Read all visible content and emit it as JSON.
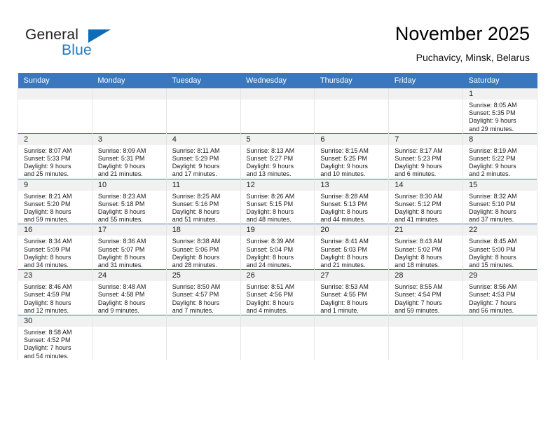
{
  "logo": {
    "word1": "General",
    "word2": "Blue",
    "triangle_color": "#0f6cb5",
    "blue_text_color": "#1a7bc4"
  },
  "header": {
    "title": "November 2025",
    "subtitle": "Puchavicy, Minsk, Belarus"
  },
  "theme": {
    "header_row_bg": "#3b77bc",
    "header_row_text": "#ffffff",
    "daynum_band_bg": "#f1f1f1",
    "cell_bg": "#ffffff",
    "row_divider": "#3b77bc",
    "cell_border": "#e4e4e4"
  },
  "weekdays": [
    "Sunday",
    "Monday",
    "Tuesday",
    "Wednesday",
    "Thursday",
    "Friday",
    "Saturday"
  ],
  "weeks": [
    [
      {
        "day": "",
        "lines": []
      },
      {
        "day": "",
        "lines": []
      },
      {
        "day": "",
        "lines": []
      },
      {
        "day": "",
        "lines": []
      },
      {
        "day": "",
        "lines": []
      },
      {
        "day": "",
        "lines": []
      },
      {
        "day": "1",
        "lines": [
          "Sunrise: 8:05 AM",
          "Sunset: 5:35 PM",
          "Daylight: 9 hours",
          "and 29 minutes."
        ]
      }
    ],
    [
      {
        "day": "2",
        "lines": [
          "Sunrise: 8:07 AM",
          "Sunset: 5:33 PM",
          "Daylight: 9 hours",
          "and 25 minutes."
        ]
      },
      {
        "day": "3",
        "lines": [
          "Sunrise: 8:09 AM",
          "Sunset: 5:31 PM",
          "Daylight: 9 hours",
          "and 21 minutes."
        ]
      },
      {
        "day": "4",
        "lines": [
          "Sunrise: 8:11 AM",
          "Sunset: 5:29 PM",
          "Daylight: 9 hours",
          "and 17 minutes."
        ]
      },
      {
        "day": "5",
        "lines": [
          "Sunrise: 8:13 AM",
          "Sunset: 5:27 PM",
          "Daylight: 9 hours",
          "and 13 minutes."
        ]
      },
      {
        "day": "6",
        "lines": [
          "Sunrise: 8:15 AM",
          "Sunset: 5:25 PM",
          "Daylight: 9 hours",
          "and 10 minutes."
        ]
      },
      {
        "day": "7",
        "lines": [
          "Sunrise: 8:17 AM",
          "Sunset: 5:23 PM",
          "Daylight: 9 hours",
          "and 6 minutes."
        ]
      },
      {
        "day": "8",
        "lines": [
          "Sunrise: 8:19 AM",
          "Sunset: 5:22 PM",
          "Daylight: 9 hours",
          "and 2 minutes."
        ]
      }
    ],
    [
      {
        "day": "9",
        "lines": [
          "Sunrise: 8:21 AM",
          "Sunset: 5:20 PM",
          "Daylight: 8 hours",
          "and 59 minutes."
        ]
      },
      {
        "day": "10",
        "lines": [
          "Sunrise: 8:23 AM",
          "Sunset: 5:18 PM",
          "Daylight: 8 hours",
          "and 55 minutes."
        ]
      },
      {
        "day": "11",
        "lines": [
          "Sunrise: 8:25 AM",
          "Sunset: 5:16 PM",
          "Daylight: 8 hours",
          "and 51 minutes."
        ]
      },
      {
        "day": "12",
        "lines": [
          "Sunrise: 8:26 AM",
          "Sunset: 5:15 PM",
          "Daylight: 8 hours",
          "and 48 minutes."
        ]
      },
      {
        "day": "13",
        "lines": [
          "Sunrise: 8:28 AM",
          "Sunset: 5:13 PM",
          "Daylight: 8 hours",
          "and 44 minutes."
        ]
      },
      {
        "day": "14",
        "lines": [
          "Sunrise: 8:30 AM",
          "Sunset: 5:12 PM",
          "Daylight: 8 hours",
          "and 41 minutes."
        ]
      },
      {
        "day": "15",
        "lines": [
          "Sunrise: 8:32 AM",
          "Sunset: 5:10 PM",
          "Daylight: 8 hours",
          "and 37 minutes."
        ]
      }
    ],
    [
      {
        "day": "16",
        "lines": [
          "Sunrise: 8:34 AM",
          "Sunset: 5:09 PM",
          "Daylight: 8 hours",
          "and 34 minutes."
        ]
      },
      {
        "day": "17",
        "lines": [
          "Sunrise: 8:36 AM",
          "Sunset: 5:07 PM",
          "Daylight: 8 hours",
          "and 31 minutes."
        ]
      },
      {
        "day": "18",
        "lines": [
          "Sunrise: 8:38 AM",
          "Sunset: 5:06 PM",
          "Daylight: 8 hours",
          "and 28 minutes."
        ]
      },
      {
        "day": "19",
        "lines": [
          "Sunrise: 8:39 AM",
          "Sunset: 5:04 PM",
          "Daylight: 8 hours",
          "and 24 minutes."
        ]
      },
      {
        "day": "20",
        "lines": [
          "Sunrise: 8:41 AM",
          "Sunset: 5:03 PM",
          "Daylight: 8 hours",
          "and 21 minutes."
        ]
      },
      {
        "day": "21",
        "lines": [
          "Sunrise: 8:43 AM",
          "Sunset: 5:02 PM",
          "Daylight: 8 hours",
          "and 18 minutes."
        ]
      },
      {
        "day": "22",
        "lines": [
          "Sunrise: 8:45 AM",
          "Sunset: 5:00 PM",
          "Daylight: 8 hours",
          "and 15 minutes."
        ]
      }
    ],
    [
      {
        "day": "23",
        "lines": [
          "Sunrise: 8:46 AM",
          "Sunset: 4:59 PM",
          "Daylight: 8 hours",
          "and 12 minutes."
        ]
      },
      {
        "day": "24",
        "lines": [
          "Sunrise: 8:48 AM",
          "Sunset: 4:58 PM",
          "Daylight: 8 hours",
          "and 9 minutes."
        ]
      },
      {
        "day": "25",
        "lines": [
          "Sunrise: 8:50 AM",
          "Sunset: 4:57 PM",
          "Daylight: 8 hours",
          "and 7 minutes."
        ]
      },
      {
        "day": "26",
        "lines": [
          "Sunrise: 8:51 AM",
          "Sunset: 4:56 PM",
          "Daylight: 8 hours",
          "and 4 minutes."
        ]
      },
      {
        "day": "27",
        "lines": [
          "Sunrise: 8:53 AM",
          "Sunset: 4:55 PM",
          "Daylight: 8 hours",
          "and 1 minute."
        ]
      },
      {
        "day": "28",
        "lines": [
          "Sunrise: 8:55 AM",
          "Sunset: 4:54 PM",
          "Daylight: 7 hours",
          "and 59 minutes."
        ]
      },
      {
        "day": "29",
        "lines": [
          "Sunrise: 8:56 AM",
          "Sunset: 4:53 PM",
          "Daylight: 7 hours",
          "and 56 minutes."
        ]
      }
    ],
    [
      {
        "day": "30",
        "lines": [
          "Sunrise: 8:58 AM",
          "Sunset: 4:52 PM",
          "Daylight: 7 hours",
          "and 54 minutes."
        ]
      },
      {
        "day": "",
        "lines": []
      },
      {
        "day": "",
        "lines": []
      },
      {
        "day": "",
        "lines": []
      },
      {
        "day": "",
        "lines": []
      },
      {
        "day": "",
        "lines": []
      },
      {
        "day": "",
        "lines": []
      }
    ]
  ]
}
